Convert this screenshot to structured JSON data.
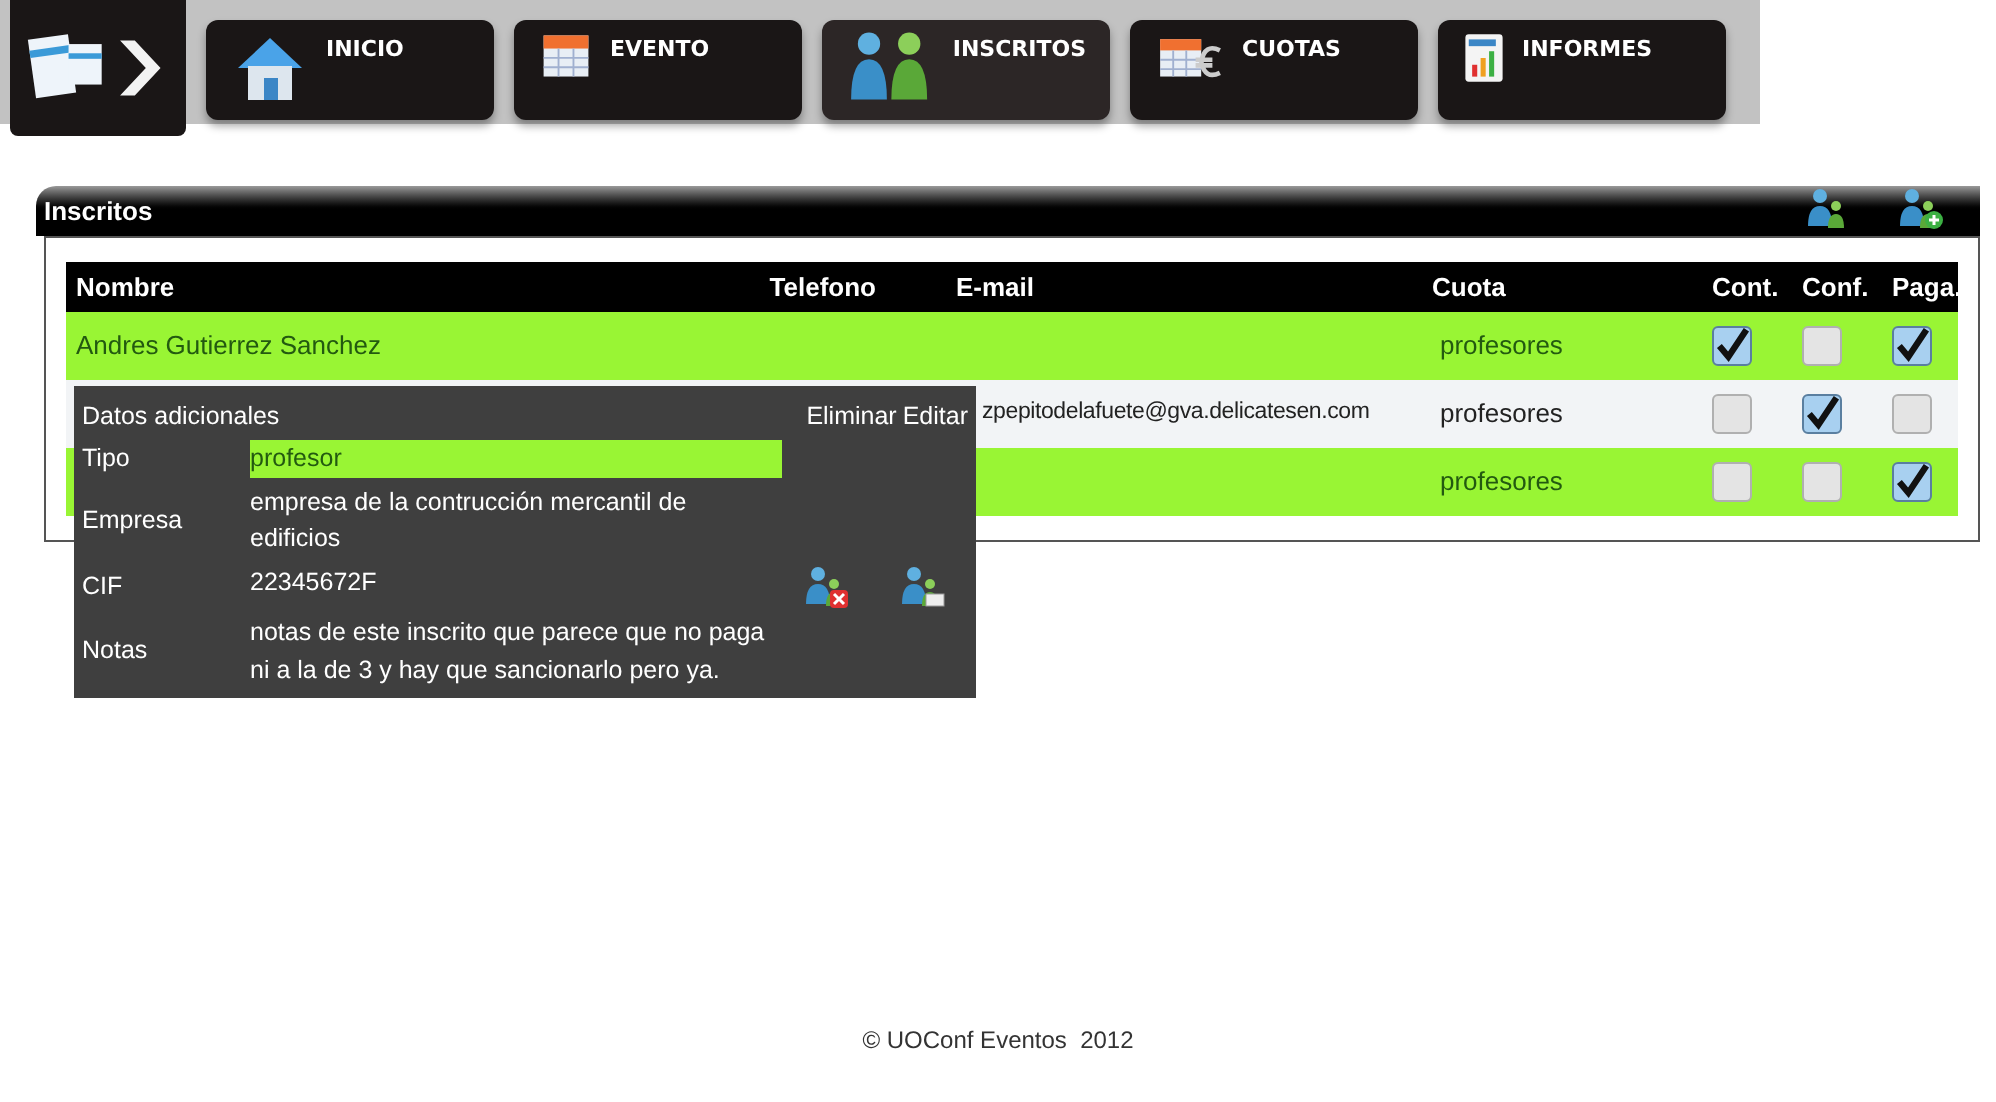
{
  "nav": {
    "tabs": [
      {
        "label": "INICIO",
        "selected": false
      },
      {
        "label": "EVENTO",
        "selected": false
      },
      {
        "label": "INSCRITOS",
        "selected": true
      },
      {
        "label": "CUOTAS",
        "selected": false
      },
      {
        "label": "INFORMES",
        "selected": false
      }
    ]
  },
  "panel": {
    "title": "Inscritos",
    "table": {
      "columns": [
        "Nombre",
        "Telefono",
        "E-mail",
        "Cuota",
        "Cont.",
        "Conf.",
        "Paga."
      ],
      "rows": [
        {
          "nombre": "Andres Gutierrez Sanchez",
          "email": "",
          "cuota": "profesores",
          "cont": true,
          "conf": false,
          "paga": true,
          "selected": false
        },
        {
          "nombre": "",
          "email": "zpepitodelafuete@gva.delicatesen.com",
          "cuota": "profesores",
          "cont": false,
          "conf": true,
          "paga": false,
          "selected": true
        },
        {
          "nombre": "",
          "email": "",
          "cuota": "profesores",
          "cont": false,
          "conf": false,
          "paga": true,
          "selected": false
        }
      ]
    }
  },
  "popup": {
    "title": "Datos adicionales",
    "actions": [
      "Eliminar",
      "Editar"
    ],
    "fields": [
      {
        "label": "Tipo",
        "value": "profesor",
        "highlighted": true
      },
      {
        "label": "Empresa",
        "value": "empresa de la contrucción mercantil de edificios",
        "highlighted": false
      },
      {
        "label": "CIF",
        "value": "22345672F",
        "highlighted": false
      },
      {
        "label": "Notas",
        "value": "notas de este inscrito que parece que no paga ni a la de 3 y hay que sancionarlo pero ya.",
        "highlighted": false
      }
    ]
  },
  "footer": "© UOConf Eventos  2012"
}
